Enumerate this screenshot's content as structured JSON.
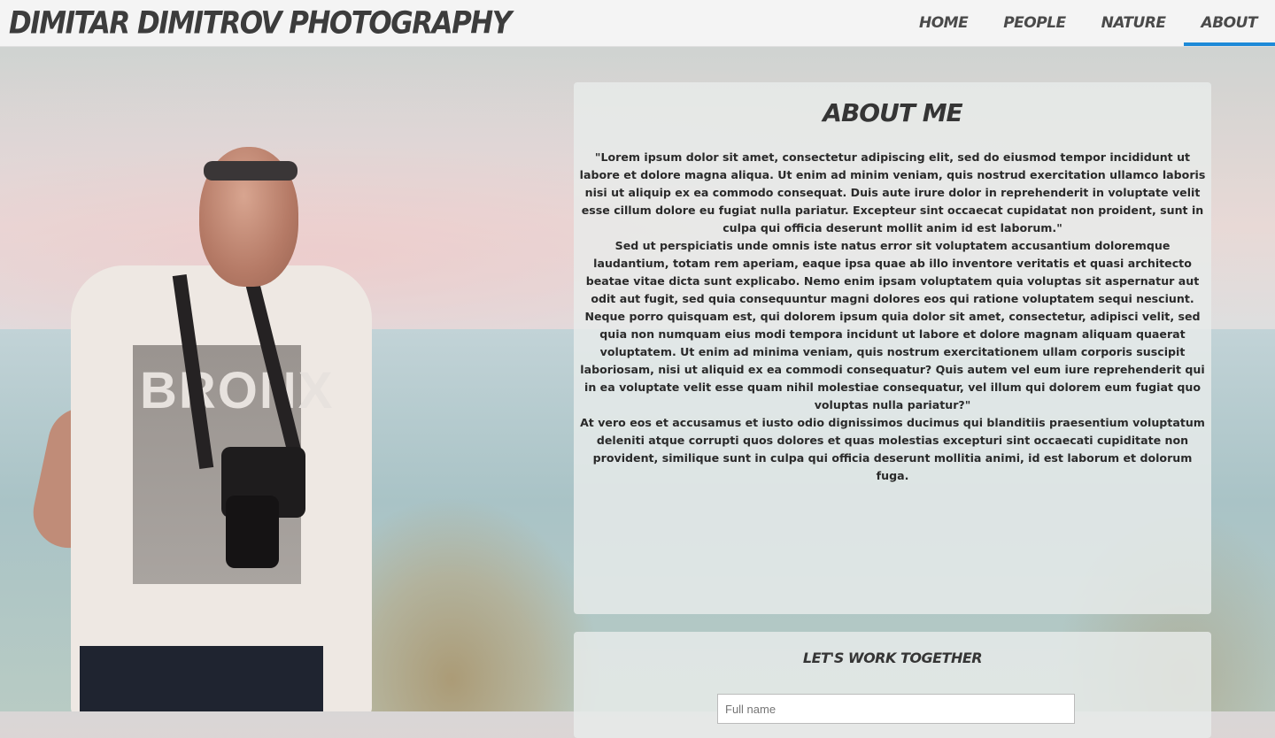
{
  "header": {
    "brand": "DIMITAR DIMITROV PHOTOGRAPHY",
    "nav": [
      {
        "label": "HOME"
      },
      {
        "label": "PEOPLE"
      },
      {
        "label": "NATURE"
      },
      {
        "label": "ABOUT",
        "active": true
      }
    ],
    "accent_color": "#1d8ad8"
  },
  "photo": {
    "shirt_text": "BRONX"
  },
  "about": {
    "title": "ABOUT ME",
    "paragraph1": "\"Lorem ipsum dolor sit amet, consectetur adipiscing elit, sed do eiusmod tempor incididunt ut labore et dolore magna aliqua. Ut enim ad minim veniam, quis nostrud exercitation ullamco laboris nisi ut aliquip ex ea commodo consequat. Duis aute irure dolor in reprehenderit in voluptate velit esse cillum dolore eu fugiat nulla pariatur. Excepteur sint occaecat cupidatat non proident, sunt in culpa qui officia deserunt mollit anim id est laborum.\"",
    "paragraph2": "Sed ut perspiciatis unde omnis iste natus error sit voluptatem accusantium doloremque laudantium, totam rem aperiam, eaque ipsa quae ab illo inventore veritatis et quasi architecto beatae vitae dicta sunt explicabo. Nemo enim ipsam voluptatem quia voluptas sit aspernatur aut odit aut fugit, sed quia consequuntur magni dolores eos qui ratione voluptatem sequi nesciunt. Neque porro quisquam est, qui dolorem ipsum quia dolor sit amet, consectetur, adipisci velit, sed quia non numquam eius modi tempora incidunt ut labore et dolore magnam aliquam quaerat voluptatem. Ut enim ad minima veniam, quis nostrum exercitationem ullam corporis suscipit laboriosam, nisi ut aliquid ex ea commodi consequatur? Quis autem vel eum iure reprehenderit qui in ea voluptate velit esse quam nihil molestiae consequatur, vel illum qui dolorem eum fugiat quo voluptas nulla pariatur?\"",
    "paragraph3": "At vero eos et accusamus et iusto odio dignissimos ducimus qui blanditiis praesentium voluptatum deleniti atque corrupti quos dolores et quas molestias excepturi sint occaecati cupiditate non provident, similique sunt in culpa qui officia deserunt mollitia animi, id est laborum et dolorum fuga."
  },
  "work": {
    "title": "LET'S WORK TOGETHER",
    "name_placeholder": "Full name"
  }
}
